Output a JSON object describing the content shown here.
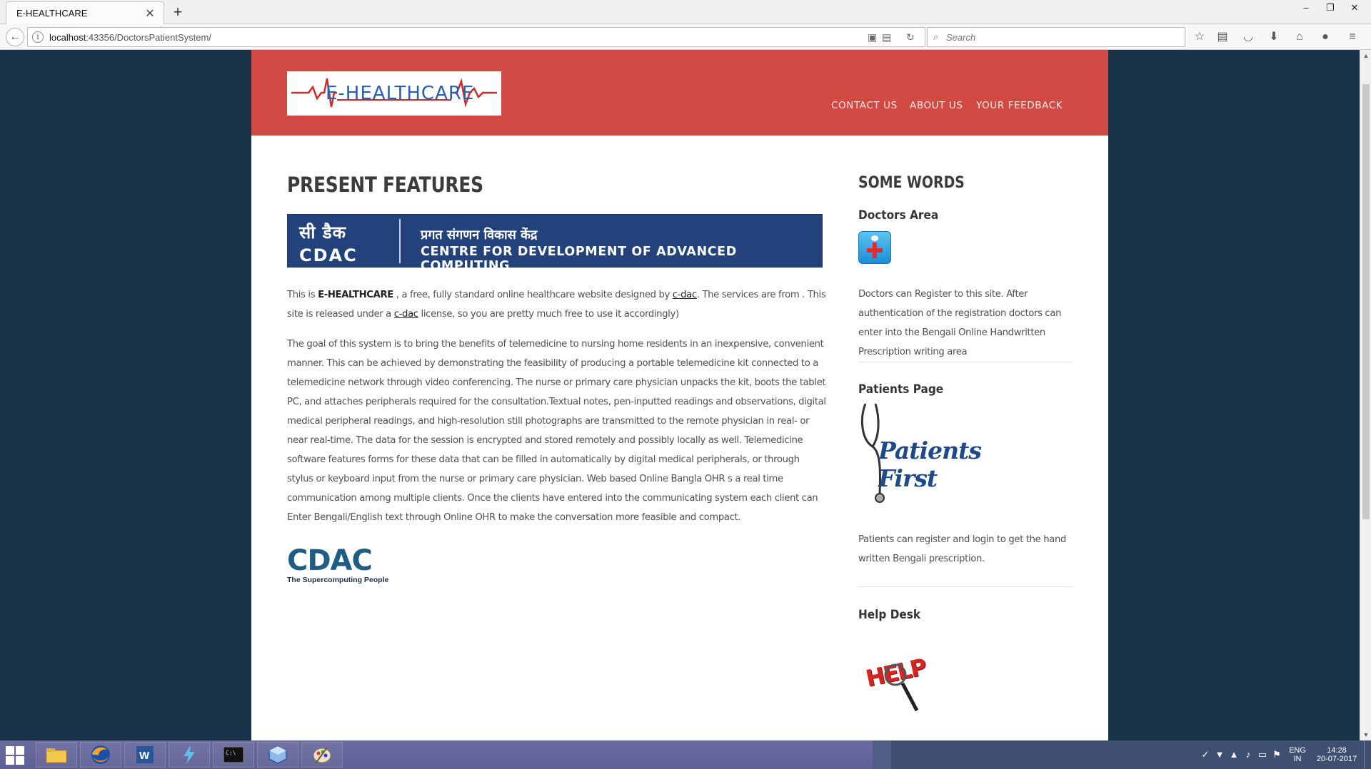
{
  "browser": {
    "tab_title": "E-HEALTHCARE",
    "tab_close": "✕",
    "new_tab": "+",
    "url_host": "localhost",
    "url_path": ":43356/DoctorsPatientSystem/",
    "search_placeholder": "Search",
    "window_controls": [
      "–",
      "❐",
      "✕"
    ]
  },
  "site": {
    "logo_text": "E-HEALTHCARE",
    "nav": [
      "CONTACT US",
      "ABOUT US",
      "YOUR FEEDBACK"
    ]
  },
  "main": {
    "title": "PRESENT FEATURES",
    "banner": {
      "hindi_short": "सी डैक",
      "cdac": "CDAC",
      "hindi_long": "प्रगत संगणन विकास केंद्र",
      "english": "CENTRE FOR DEVELOPMENT OF ADVANCED COMPUTING"
    },
    "intro": {
      "t1": "This is ",
      "brand": "E-HEALTHCARE",
      "t2": " , a free, fully standard online healthcare website designed by ",
      "link1": "c-dac",
      "t3": ". The services are from . This site is released under a ",
      "link2": "c-dac",
      "t4": " license, so you are pretty much free to use it accordingly)"
    },
    "body": "The goal of this system is to bring the benefits of telemedicine to nursing home residents in an inexpensive, convenient manner. This can be achieved by demonstrating the feasibility of producing a portable telemedicine kit connected to a telemedicine network through video conferencing. The nurse or primary care physician unpacks the kit, boots the tablet PC, and attaches peripherals required for the consultation.Textual notes, pen-inputted readings and observations, digital medical peripheral readings, and high-resolution still photographs are transmitted to the remote physician in real- or near real-time. The data for the session is encrypted and stored remotely and possibly locally as well. Telemedicine software features forms for these data that can be filled in automatically by digital medical peripherals, or through stylus or keyboard input from the nurse or primary care physician. Web based Online Bangla OHR s a real time communication among multiple clients. Once the clients have entered into the communicating system each client can Enter Bengali/English text through Online OHR to make the conversation more feasible and compact.",
    "footer_logo": {
      "letters": "CDAC",
      "tagline": "The Supercomputing People"
    }
  },
  "sidebar": {
    "title": "SOME WORDS",
    "doctors_heading": "Doctors Area",
    "doctors_text": "Doctors can Register to this site. After authentication of the registration doctors can enter into the Bengali Online Handwritten Prescription writing area",
    "patients_heading": "Patients Page",
    "patients_logo_text": "Patients First",
    "patients_text": "Patients can register and login to get the hand written Bengali prescription.",
    "help_heading": "Help Desk",
    "help_logo_text": "HELP"
  },
  "taskbar": {
    "lang": "ENG",
    "region": "IN",
    "time": "14:28",
    "date": "20-07-2017"
  },
  "colors": {
    "header_red": "#d04a43",
    "page_bg": "#18334a",
    "banner_blue": "#23427c"
  }
}
